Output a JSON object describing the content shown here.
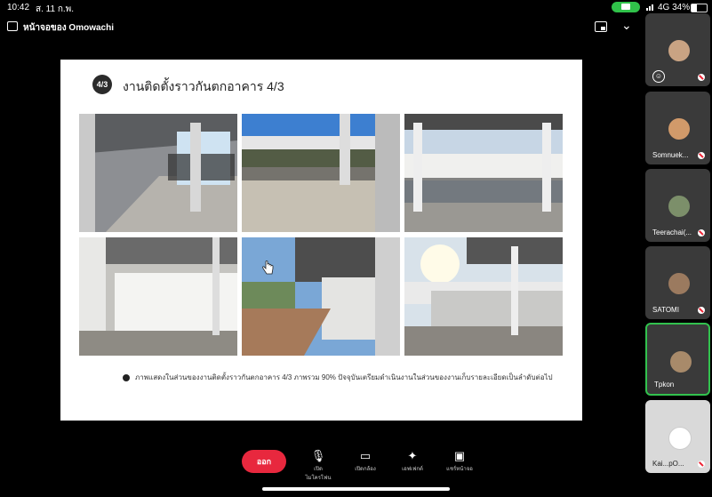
{
  "status_bar": {
    "time": "10:42",
    "date": "ส. 11 ก.พ.",
    "network": "4G 34%",
    "battery_level": 0.34
  },
  "topbar": {
    "title": "หน้าจอของ Omowachi"
  },
  "slide": {
    "badge": "4/3",
    "title": "งานติดตั้งราวกันตกอาคาร 4/3",
    "caption": "ภาพแสดงในส่วนของงานติดตั้งราวกันตกอาคาร 4/3 ภาพรวม 90% ปัจจุบันเตรียมดำเนินงานในส่วนของงานเก็บรายละเอียดเป็นลำดับต่อไป"
  },
  "participants": [
    {
      "name": ""
    },
    {
      "name": "Somnuek..."
    },
    {
      "name": "Teerachai(..."
    },
    {
      "name": "SATOMI"
    },
    {
      "name": "Tpkon"
    },
    {
      "name": "Kai...pO..."
    }
  ],
  "controls": {
    "leave": "ออก",
    "mic": "เปิด\nไมโครโฟน",
    "camera": "เปิดกล้อง",
    "effects": "เอฟเฟกต์",
    "share": "แชร์หน้าจอ"
  },
  "colors": {
    "leave_button": "#e8283e",
    "active_speaker_border": "#32c24e",
    "camera_pill": "#30c24a"
  }
}
